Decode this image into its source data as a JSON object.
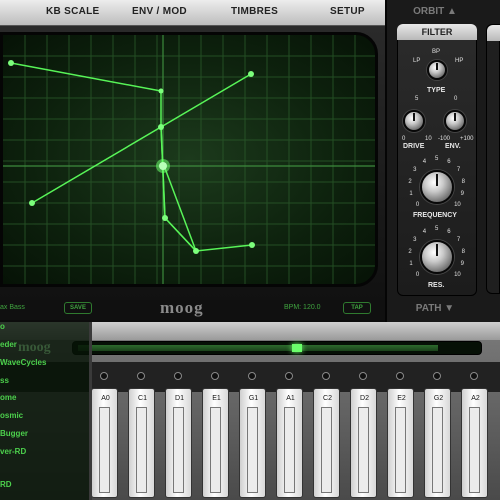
{
  "menu": {
    "kb_scale": "KB SCALE",
    "env_mod": "ENV / MOD",
    "timbres": "TIMBRES",
    "setup": "SETUP"
  },
  "panel": {
    "orbit": "ORBIT ▲",
    "path": "PATH ▼",
    "filter": "FILTER"
  },
  "filter": {
    "type_label": "TYPE",
    "lp": "LP",
    "bp": "BP",
    "hp": "HP",
    "drive_label": "DRIVE",
    "env_label": "ENV.",
    "drive_scale_top": "5",
    "drive_scale_left": "0",
    "drive_scale_right": "10",
    "env_scale_top": "0",
    "env_scale_left": "-100",
    "env_scale_right": "+100",
    "frequency_label": "FREQUENCY",
    "res_label": "RES.",
    "freq_ticks": [
      "0",
      "1",
      "2",
      "3",
      "4",
      "5",
      "6",
      "7",
      "8",
      "9",
      "10"
    ],
    "res_ticks": [
      "0",
      "1",
      "2",
      "3",
      "4",
      "5",
      "6",
      "7",
      "8",
      "9",
      "10"
    ]
  },
  "scope": {
    "preset_name": "ax Bass",
    "save": "SAVE",
    "logo": "moog",
    "bpm": "BPM: 120.0",
    "tap": "TAP"
  },
  "presets": [
    "o",
    "eder",
    "WaveCycles",
    "ss",
    "ome",
    "osmic",
    "Bugger",
    "ver-RD",
    "RD"
  ],
  "keys": [
    "A0",
    "C1",
    "D1",
    "E1",
    "G1",
    "A1",
    "C2",
    "D2",
    "E2",
    "G2",
    "A2"
  ],
  "colors": {
    "trace": "#5cff5c",
    "grid": "#2a5a2a",
    "accent": "#4cd04c"
  }
}
